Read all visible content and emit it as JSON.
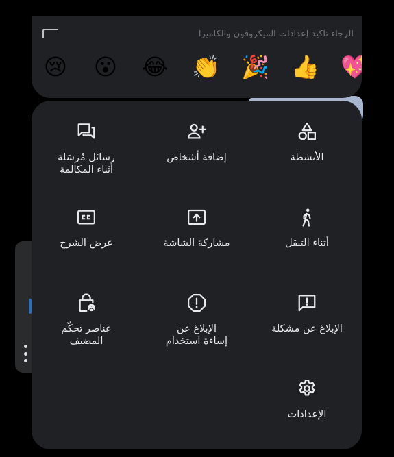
{
  "reactions": {
    "cut_text": "الرجاء تأكيد إعدادات الميكروفون والكاميرا",
    "emojis": [
      {
        "name": "crying-face-emoji",
        "glyph": "😢"
      },
      {
        "name": "surprised-face-emoji",
        "glyph": "😮"
      },
      {
        "name": "tears-of-joy-emoji",
        "glyph": "😂"
      },
      {
        "name": "clapping-hands-emoji",
        "glyph": "👏"
      },
      {
        "name": "party-popper-emoji",
        "glyph": "🎉"
      },
      {
        "name": "thumbs-up-emoji",
        "glyph": "👍"
      },
      {
        "name": "sparkling-heart-emoji",
        "glyph": "💖"
      }
    ]
  },
  "menu": {
    "chat_label": "رسائل مُرسَلة\nأثناء المكالمة",
    "add_people_label": "إضافة أشخاص",
    "activities_label": "الأنشطة",
    "captions_label": "عرض الشرح",
    "share_screen_label": "مشاركة الشاشة",
    "on_the_go_label": "أثناء التنقل",
    "host_controls_label": "عناصر تحكّم\nالمضيف",
    "report_abuse_label": "الإبلاغ عن\nإساءة استخدام",
    "report_problem_label": "الإبلاغ عن مشكلة",
    "settings_label": "الإعدادات"
  },
  "colors": {
    "sheet_bg": "#202124",
    "icon": "#e8eaed",
    "text": "#e8eaed",
    "background": "#000000"
  }
}
